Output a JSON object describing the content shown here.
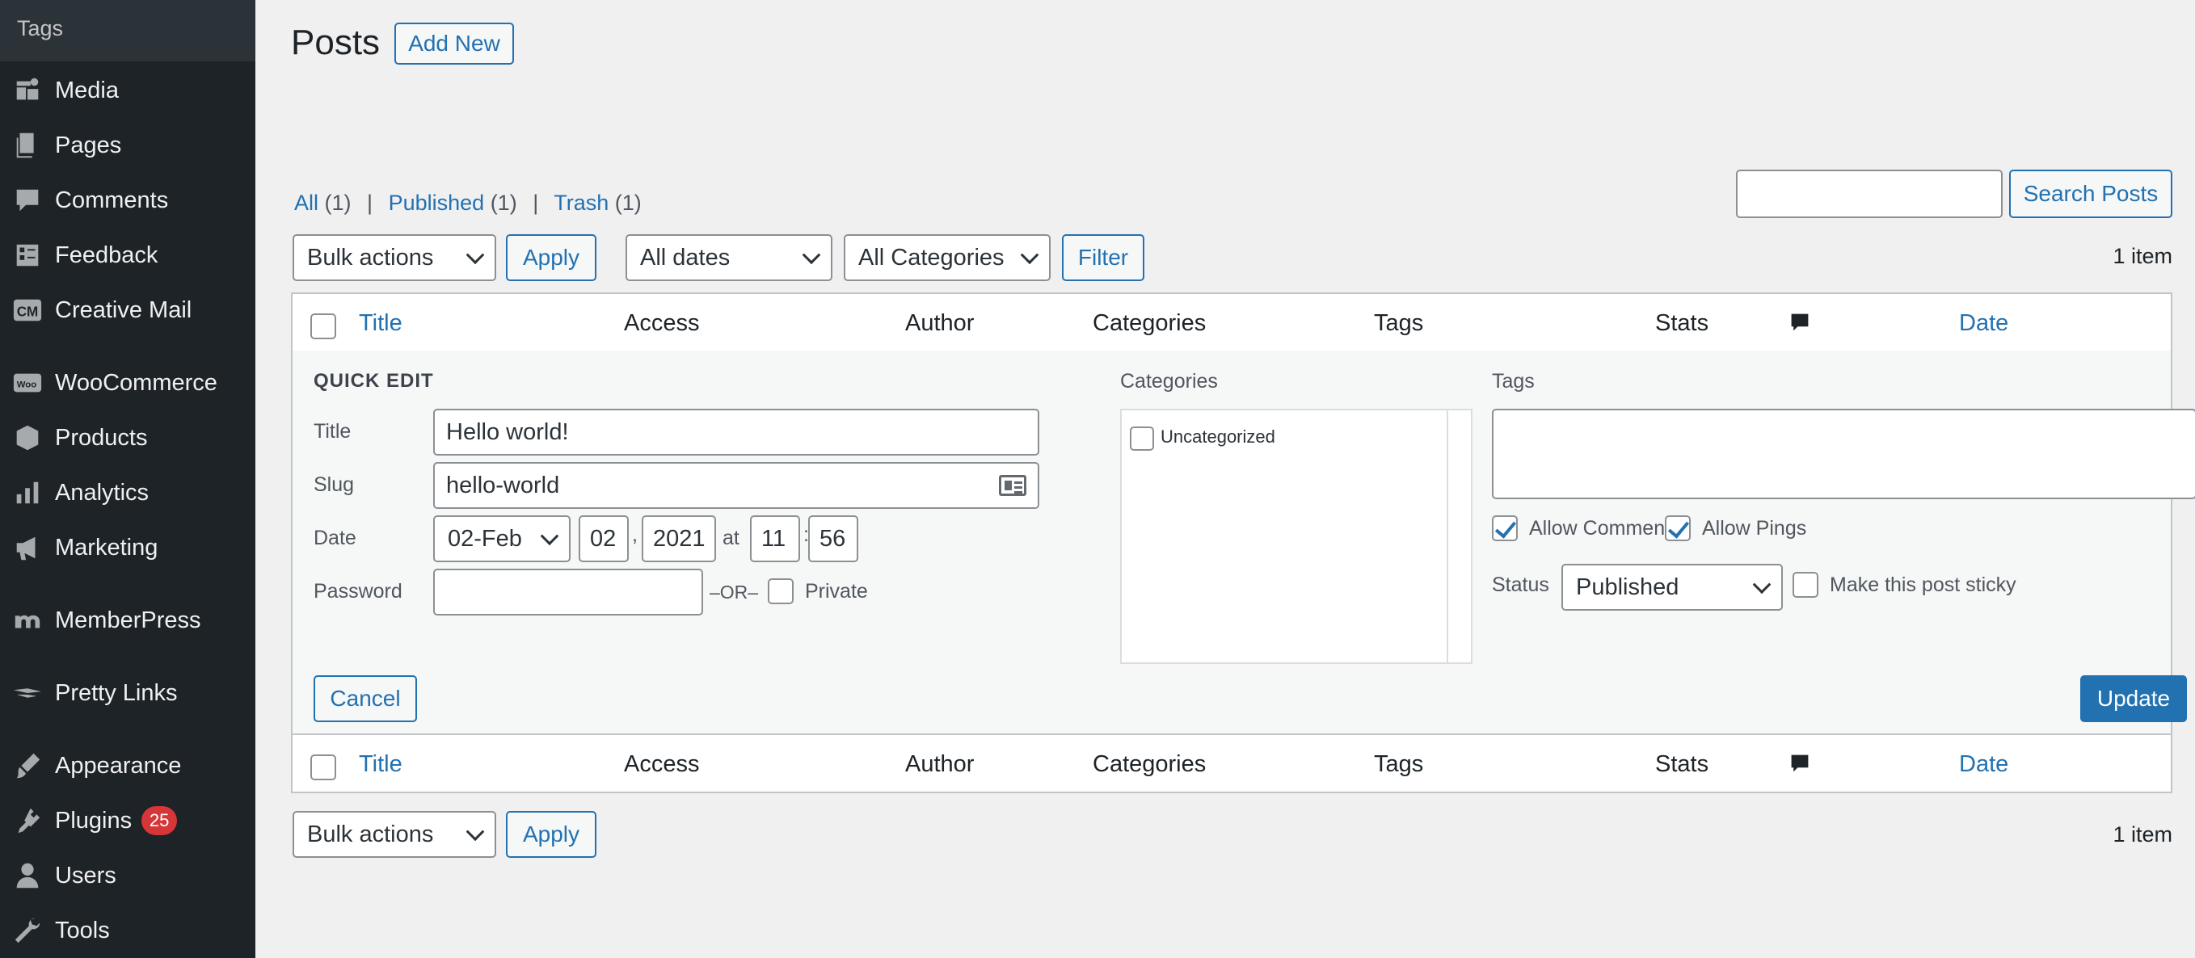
{
  "sidebar": {
    "top_item": "Tags",
    "items": [
      {
        "label": "Media",
        "icon": "media-icon"
      },
      {
        "label": "Pages",
        "icon": "pages-icon"
      },
      {
        "label": "Comments",
        "icon": "comments-icon"
      },
      {
        "label": "Feedback",
        "icon": "feedback-icon"
      },
      {
        "label": "Creative Mail",
        "icon": "creative-mail-icon"
      },
      {
        "label": "WooCommerce",
        "icon": "woocommerce-icon"
      },
      {
        "label": "Products",
        "icon": "products-icon"
      },
      {
        "label": "Analytics",
        "icon": "analytics-icon"
      },
      {
        "label": "Marketing",
        "icon": "marketing-icon"
      },
      {
        "label": "MemberPress",
        "icon": "memberpress-icon"
      },
      {
        "label": "Pretty Links",
        "icon": "pretty-links-icon"
      },
      {
        "label": "Appearance",
        "icon": "appearance-icon"
      },
      {
        "label": "Plugins",
        "icon": "plugins-icon",
        "badge": "25"
      },
      {
        "label": "Users",
        "icon": "users-icon"
      },
      {
        "label": "Tools",
        "icon": "tools-icon"
      }
    ]
  },
  "header": {
    "title": "Posts",
    "add_new": "Add New"
  },
  "views": {
    "all": "All",
    "all_count": "(1)",
    "published": "Published",
    "published_count": "(1)",
    "trash": "Trash",
    "trash_count": "(1)",
    "separator": "|"
  },
  "search": {
    "value": "",
    "button": "Search Posts"
  },
  "toolbar": {
    "bulk_actions": "Bulk actions",
    "apply": "Apply",
    "all_dates": "All dates",
    "all_categories": "All Categories",
    "filter": "Filter",
    "item_count": "1 item"
  },
  "table": {
    "columns": {
      "title": "Title",
      "access": "Access",
      "author": "Author",
      "categories": "Categories",
      "tags": "Tags",
      "stats": "Stats",
      "date": "Date"
    }
  },
  "quick_edit": {
    "heading": "QUICK EDIT",
    "title_label": "Title",
    "title_value": "Hello world!",
    "slug_label": "Slug",
    "slug_value": "hello-world",
    "date_label": "Date",
    "month": "02-Feb",
    "day": "02",
    "comma": ",",
    "year": "2021",
    "at": "at",
    "hour": "11",
    "colon": ":",
    "minute": "56",
    "password_label": "Password",
    "password_value": "",
    "or": "–OR–",
    "private_label": "Private",
    "private_checked": false,
    "categories_label": "Categories",
    "categories": [
      {
        "label": "Uncategorized",
        "checked": false
      }
    ],
    "tags_label": "Tags",
    "tags_value": "",
    "allow_comments": "Allow Comments",
    "allow_comments_checked": true,
    "allow_pings": "Allow Pings",
    "allow_pings_checked": true,
    "status_label": "Status",
    "status_value": "Published",
    "sticky_label": "Make this post sticky",
    "sticky_checked": false,
    "cancel": "Cancel",
    "update": "Update"
  },
  "colors": {
    "accent": "#2271b1",
    "sidebar_bg": "#1d2327",
    "badge": "#d63638"
  }
}
